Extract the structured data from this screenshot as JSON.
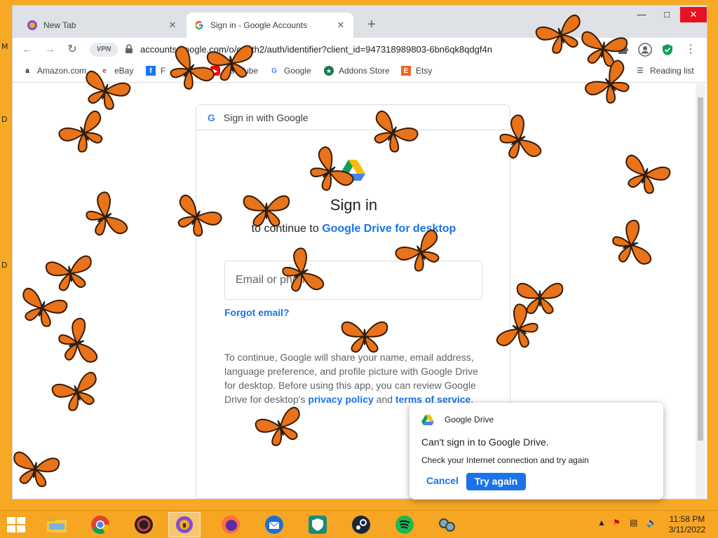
{
  "desktop": {
    "edge_letters": [
      "M",
      "D",
      "D"
    ]
  },
  "browser": {
    "tabs": [
      {
        "title": "New Tab",
        "favicon": "browser-logo-icon",
        "active": false
      },
      {
        "title": "Sign in - Google Accounts",
        "favicon": "google-g-icon",
        "active": true
      }
    ],
    "new_tab": "+",
    "window_controls": {
      "minimize": "—",
      "maximize": "□",
      "close": "✕"
    },
    "vpn_label": "VPN",
    "url": "accounts.google.com/o/oauth2/auth/identifier?client_id=947318989803-6bn6qk8qdgf4n",
    "bookmarks": [
      {
        "label": "Amazon.com",
        "icon": "amazon-icon"
      },
      {
        "label": "eBay",
        "icon": "ebay-icon"
      },
      {
        "label": "F",
        "icon": "facebook-icon"
      },
      {
        "label": "YouTube",
        "icon": "youtube-icon"
      },
      {
        "label": "Google",
        "icon": "google-g-icon"
      },
      {
        "label": "Addons Store",
        "icon": "addons-store-icon"
      },
      {
        "label": "Etsy",
        "icon": "etsy-icon"
      }
    ],
    "reading_list": "Reading list"
  },
  "signin": {
    "header": "Sign in with Google",
    "title": "Sign in",
    "subtitle_prefix": "to continue to",
    "app_name": "Google Drive for desktop",
    "email_placeholder": "Email or phone",
    "forgot_email": "Forgot email?",
    "disclaimer_text": "To continue, Google will share your name, email address, language preference, and profile picture with Google Drive for desktop. Before using this app, you can review Google Drive for desktop's",
    "privacy_policy": "privacy policy",
    "and": "and",
    "terms": "terms of service",
    "period": "."
  },
  "dialog": {
    "app": "Google Drive",
    "title": "Can't sign in to Google Drive.",
    "message": "Check your Internet connection and try again",
    "cancel": "Cancel",
    "retry": "Try again"
  },
  "taskbar": {
    "apps": [
      "file-explorer-icon",
      "chrome-icon",
      "gaming-app-icon",
      "privacy-browser-icon",
      "firefox-icon",
      "thunderbird-icon",
      "vpn-shield-icon",
      "steam-icon",
      "spotify-icon",
      "network-app-icon"
    ],
    "time": "11:58 PM",
    "date": "3/11/2022"
  },
  "colors": {
    "accent": "#1a73e8",
    "desktop": "#f6a623",
    "butterfly": "#e8731a"
  }
}
